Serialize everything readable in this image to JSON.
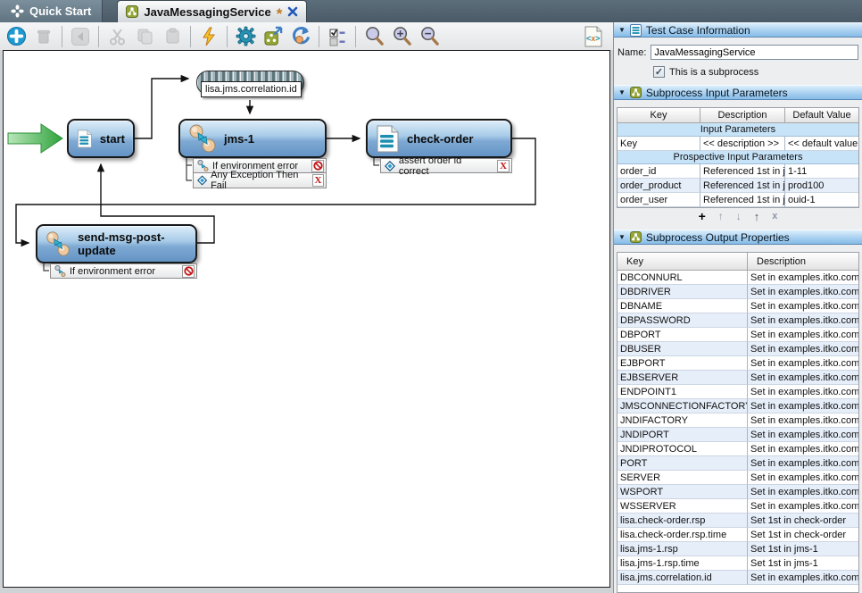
{
  "window": {
    "tabs": [
      {
        "label": "Quick Start",
        "icon": "lisa-pinwheel-icon",
        "active": false
      },
      {
        "label": "JavaMessagingService",
        "icon": "subprocess-icon",
        "modified_marker": "*",
        "closable": true,
        "active": true
      }
    ]
  },
  "toolbar": {
    "buttons": [
      {
        "name": "add-step",
        "icon": "plus-circle-icon",
        "enabled": true
      },
      {
        "name": "delete-step",
        "icon": "trash-icon",
        "enabled": false
      },
      {
        "name": "navigate-back",
        "icon": "arrow-left-icon",
        "enabled": false
      },
      {
        "name": "cut",
        "icon": "scissors-icon",
        "enabled": false
      },
      {
        "name": "copy",
        "icon": "copy-pages-icon",
        "enabled": false
      },
      {
        "name": "paste",
        "icon": "clipboard-icon",
        "enabled": false
      },
      {
        "name": "run",
        "icon": "lightning-bolt-icon",
        "enabled": true
      },
      {
        "name": "settings",
        "icon": "gear-icon",
        "enabled": true
      },
      {
        "name": "export-subprocess",
        "icon": "subprocess-export-icon",
        "enabled": true
      },
      {
        "name": "revert",
        "icon": "circular-arrow-icon",
        "enabled": true
      },
      {
        "name": "checklist",
        "icon": "checklist-icon",
        "enabled": true
      },
      {
        "name": "zoom-reset",
        "icon": "magnifier-icon",
        "enabled": true
      },
      {
        "name": "zoom-in",
        "icon": "magnifier-plus-icon",
        "enabled": true
      },
      {
        "name": "zoom-out",
        "icon": "magnifier-minus-icon",
        "enabled": true
      },
      {
        "name": "xml-source",
        "icon": "xml-document-icon",
        "enabled": true
      }
    ]
  },
  "diagram": {
    "buffer_label": "lisa.jms.correlation.id",
    "nodes": {
      "start": {
        "label": "start"
      },
      "jms1": {
        "label": "jms-1",
        "assertions": [
          {
            "label": "If environment error",
            "icon": "step-link-icon",
            "action_icon": "no-entry-icon"
          },
          {
            "label": "Any Exception Then Fail",
            "icon": "diamond-icon",
            "action_icon": "red-x-icon"
          }
        ]
      },
      "check_order": {
        "label": "check-order",
        "assertions": [
          {
            "label": "assert order id correct",
            "icon": "diamond-icon",
            "action_icon": "red-x-icon"
          }
        ]
      },
      "send_msg": {
        "label": "send-msg-post-update",
        "assertions": [
          {
            "label": "If environment error",
            "icon": "step-link-icon",
            "action_icon": "no-entry-icon"
          }
        ]
      }
    }
  },
  "panel": {
    "test_case_info": {
      "title": "Test Case Information",
      "name_label": "Name:",
      "name_value": "JavaMessagingService",
      "checkbox_label": "This is a subprocess",
      "checkbox_checked": true,
      "check_glyph": "✓"
    },
    "input_params": {
      "title": "Subprocess Input Parameters",
      "columns": [
        "Key",
        "Description",
        "Default Value"
      ],
      "group1": "Input Parameters",
      "group1_rows": [
        {
          "key": "Key",
          "description": "<< description >>",
          "default": "<< default value >>"
        }
      ],
      "group2": "Prospective Input Parameters",
      "group2_rows": [
        {
          "key": "order_id",
          "description": "Referenced 1st in j...",
          "default": "1-11"
        },
        {
          "key": "order_product",
          "description": "Referenced 1st in j...",
          "default": "prod100"
        },
        {
          "key": "order_user",
          "description": "Referenced 1st in j...",
          "default": "ouid-1"
        }
      ],
      "row_tools": {
        "add": "+",
        "up": "↑",
        "down": "↓",
        "promote": "↑",
        "remove": "x"
      }
    },
    "output_props": {
      "title": "Subprocess Output Properties",
      "columns": [
        "Key",
        "Description"
      ],
      "rows": [
        {
          "key": "DBCONNURL",
          "description": "Set in examples.itko.com.confi..."
        },
        {
          "key": "DBDRIVER",
          "description": "Set in examples.itko.com.confi..."
        },
        {
          "key": "DBNAME",
          "description": "Set in examples.itko.com.confi..."
        },
        {
          "key": "DBPASSWORD",
          "description": "Set in examples.itko.com.confi..."
        },
        {
          "key": "DBPORT",
          "description": "Set in examples.itko.com.confi..."
        },
        {
          "key": "DBUSER",
          "description": "Set in examples.itko.com.confi..."
        },
        {
          "key": "EJBPORT",
          "description": "Set in examples.itko.com.confi..."
        },
        {
          "key": "EJBSERVER",
          "description": "Set in examples.itko.com.confi..."
        },
        {
          "key": "ENDPOINT1",
          "description": "Set in examples.itko.com.confi..."
        },
        {
          "key": "JMSCONNECTIONFACTORY",
          "description": "Set in examples.itko.com.confi..."
        },
        {
          "key": "JNDIFACTORY",
          "description": "Set in examples.itko.com.confi..."
        },
        {
          "key": "JNDIPORT",
          "description": "Set in examples.itko.com.confi..."
        },
        {
          "key": "JNDIPROTOCOL",
          "description": "Set in examples.itko.com.confi..."
        },
        {
          "key": "PORT",
          "description": "Set in examples.itko.com.confi..."
        },
        {
          "key": "SERVER",
          "description": "Set in examples.itko.com.confi..."
        },
        {
          "key": "WSPORT",
          "description": "Set in examples.itko.com.confi..."
        },
        {
          "key": "WSSERVER",
          "description": "Set in examples.itko.com.confi..."
        },
        {
          "key": "lisa.check-order.rsp",
          "description": "Set 1st in check-order"
        },
        {
          "key": "lisa.check-order.rsp.time",
          "description": "Set 1st in check-order"
        },
        {
          "key": "lisa.jms-1.rsp",
          "description": "Set 1st in jms-1"
        },
        {
          "key": "lisa.jms-1.rsp.time",
          "description": "Set 1st in jms-1"
        },
        {
          "key": "lisa.jms.correlation.id",
          "description": "Set in examples.itko.com.confi..."
        }
      ]
    }
  },
  "colors": {
    "node_gradient_top": "#dcedf9",
    "node_gradient_bottom": "#6494c5",
    "panel_header_blue": "#a8d0f0",
    "group_row_blue": "#c7e3f8",
    "zebra_blue": "#e6eef9",
    "entry_arrow_green": "#2fa23c",
    "tab_bar_slate": "#4a5a66",
    "error_red": "#c01818",
    "subprocess_olive": "#95a637"
  }
}
